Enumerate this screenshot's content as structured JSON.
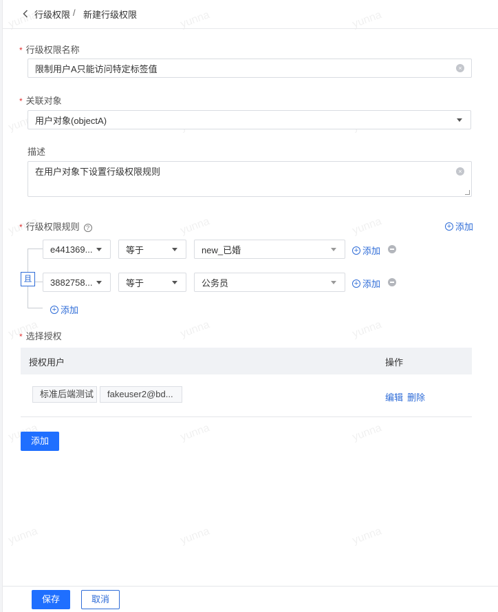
{
  "breadcrumb": {
    "parent": "行级权限",
    "separator": "/",
    "current": "新建行级权限"
  },
  "form": {
    "name": {
      "label": "行级权限名称",
      "value": "限制用户A只能访问特定标签值"
    },
    "object": {
      "label": "关联对象",
      "value": "用户对象(objectA)"
    },
    "description": {
      "label": "描述",
      "value": "在用户对象下设置行级权限规则"
    },
    "rules": {
      "label": "行级权限规则",
      "help_icon": "question-circle-icon",
      "add_label": "添加",
      "logic": "且",
      "items": [
        {
          "field": "e441369...",
          "operator": "等于",
          "value": "new_已婚",
          "add_label": "添加"
        },
        {
          "field": "3882758...",
          "operator": "等于",
          "value": "公务员",
          "add_label": "添加"
        }
      ],
      "add_condition_label": "添加"
    },
    "grant": {
      "label": "选择授权",
      "columns": {
        "user": "授权用户",
        "action": "操作"
      },
      "rows": [
        {
          "users": [
            "标准后端测试",
            "fakeuser2@bd..."
          ],
          "edit": "编辑",
          "delete": "删除"
        }
      ],
      "add_button": "添加"
    }
  },
  "footer": {
    "save": "保存",
    "cancel": "取消"
  },
  "watermark": "yunna",
  "colors": {
    "primary": "#1f6fff",
    "link": "#2d6bd7",
    "required": "#e03131"
  }
}
